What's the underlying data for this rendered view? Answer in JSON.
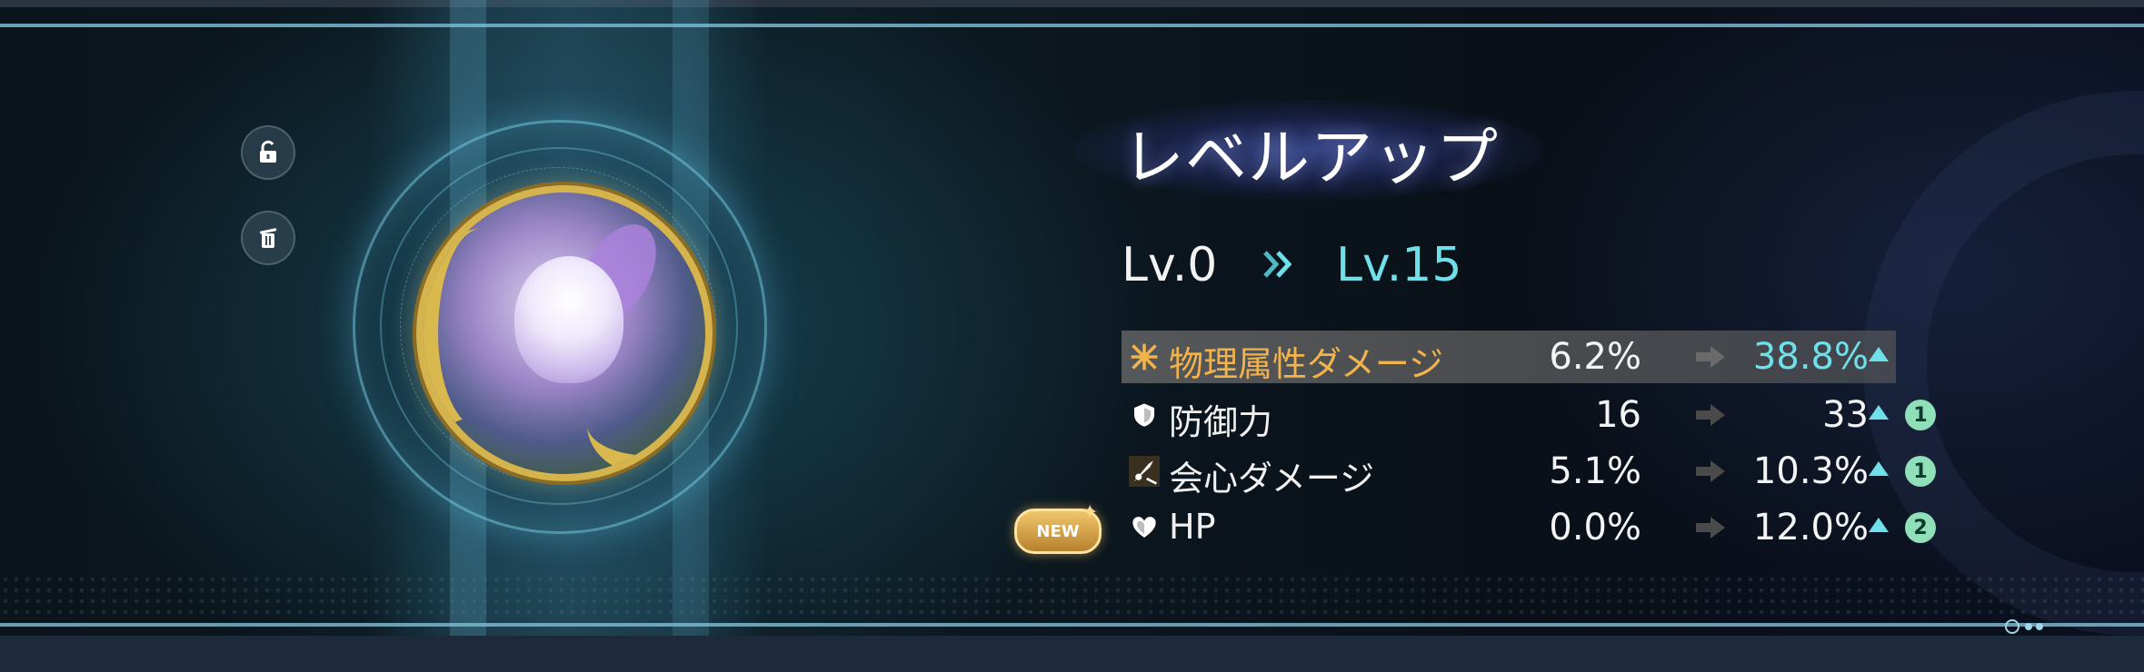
{
  "panel": {
    "title": "レベルアップ",
    "level_from": "Lv.0",
    "level_to": "Lv.15",
    "new_tag": "NEW"
  },
  "icons": {
    "lock": "unlock-icon",
    "trash": "trash-icon",
    "physical": "physical-attribute-icon",
    "defense": "shield-icon",
    "crit": "crit-icon",
    "hp": "heart-icon",
    "level_arrow": "double-chevron-right-icon",
    "stat_arrow": "arrow-right-icon",
    "up": "up-triangle-icon"
  },
  "colors": {
    "accent_cyan": "#6fe0ea",
    "highlight_orange": "#f2b34c",
    "badge_green": "#8fe0b8",
    "medal_gold": "#d5b34d"
  },
  "stats": [
    {
      "name": "物理属性ダメージ",
      "old": "6.2%",
      "new": "38.8%",
      "badge": "",
      "highlighted": true
    },
    {
      "name": "防御力",
      "old": "16",
      "new": "33",
      "badge": "1",
      "highlighted": false
    },
    {
      "name": "会心ダメージ",
      "old": "5.1%",
      "new": "10.3%",
      "badge": "1",
      "highlighted": false
    },
    {
      "name": "HP",
      "old": "0.0%",
      "new": "12.0%",
      "badge": "2",
      "highlighted": false
    }
  ]
}
